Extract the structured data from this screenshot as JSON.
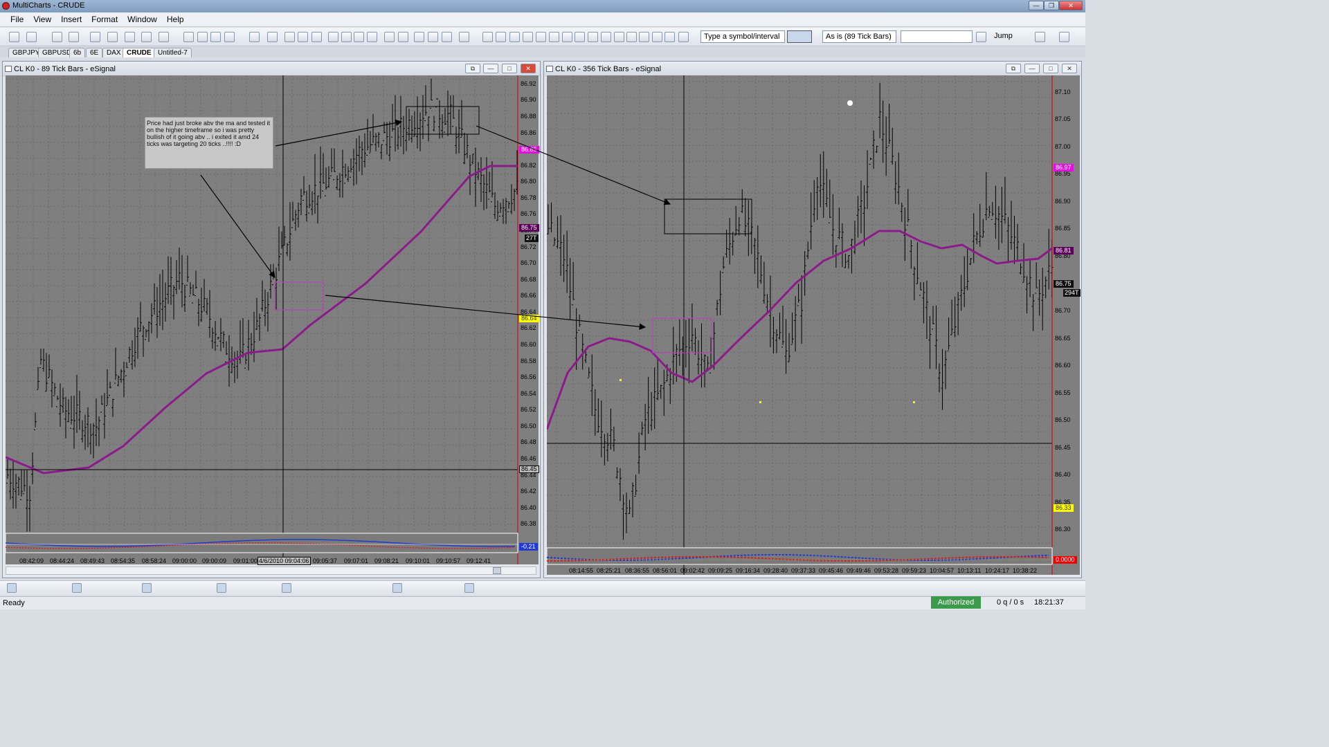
{
  "app": {
    "title": "MultiCharts - CRUDE"
  },
  "menu": [
    "File",
    "View",
    "Insert",
    "Format",
    "Window",
    "Help"
  ],
  "toolbar": {
    "symbol_placeholder": "Type a symbol/interval",
    "resolution": "As is (89 Tick Bars)",
    "jump_label": "Jump"
  },
  "tabs": [
    "GBPJPY",
    "GBPUSD",
    "6b",
    "6E",
    "DAX",
    "CRUDE",
    "Untitled-7"
  ],
  "active_tab": "CRUDE",
  "left_chart": {
    "title": "CL K0 - 89 Tick Bars - eSignal",
    "price_labels": [
      "86.92",
      "86.90",
      "86.88",
      "86.86",
      "86.84",
      "86.82",
      "86.80",
      "86.78",
      "86.76",
      "86.74",
      "86.72",
      "86.70",
      "86.68",
      "86.66",
      "86.64",
      "86.62",
      "86.60",
      "86.58",
      "86.56",
      "86.54",
      "86.52",
      "86.50",
      "86.48",
      "86.46",
      "86.44",
      "86.42",
      "86.40",
      "86.38"
    ],
    "flags": {
      "magenta": "86.85",
      "purple": "86.75",
      "ticks": "27T",
      "yellow": "86.64",
      "crosshair": "86.45",
      "indicator": "-0.21"
    },
    "time_labels": [
      "08:42:09",
      "08:44:24",
      "08:49:43",
      "08:54:35",
      "08:58:24",
      "09:00:00",
      "09:00:09",
      "09:01:00",
      "4/6/2010 09:04:06",
      "09:05:37",
      "09:07:01",
      "09:08:21",
      "09:10:01",
      "09:10:57",
      "09:12:41"
    ],
    "note": "Price had just broke abv the ma and tested it on the higher timeframe so i was pretty bullish of it going abv .. i exited it amd 24 ticks was targeting 20 ticks ..!!!! :D"
  },
  "right_chart": {
    "title": "CL K0 - 356 Tick Bars - eSignal",
    "price_labels": [
      "87.10",
      "87.05",
      "87.00",
      "86.95",
      "86.90",
      "86.85",
      "86.80",
      "86.75",
      "86.70",
      "86.65",
      "86.60",
      "86.55",
      "86.50",
      "86.45",
      "86.40",
      "86.35",
      "86.30"
    ],
    "flags": {
      "magenta": "86.97",
      "purple": "86.81",
      "dark": "86.75",
      "ticks": "294T",
      "yellow": "86.33",
      "indicator": "0.0000"
    },
    "time_labels": [
      "08:14:55",
      "08:25:21",
      "08:36:55",
      "08:56:01",
      "09:02:42",
      "09:09:25",
      "09:16:34",
      "09:28:40",
      "09:37:33",
      "09:45:46",
      "09:49:46",
      "09:53:28",
      "09:59:23",
      "10:04:57",
      "10:13:11",
      "10:24:17",
      "10:38:22"
    ]
  },
  "status": {
    "ready": "Ready",
    "authorized": "Authorized",
    "queue": "0 q / 0 s",
    "clock": "18:21:37"
  },
  "colors": {
    "plot_bg": "#7f7f7f",
    "ma": "#8b1a8b",
    "highlight_box": "#c040c0"
  }
}
